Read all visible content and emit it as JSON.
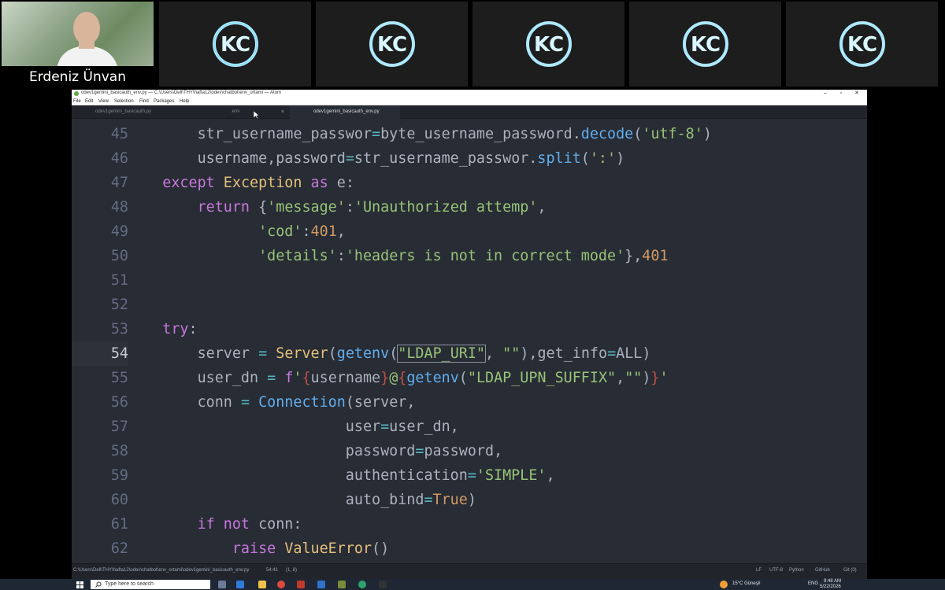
{
  "call": {
    "speaker_name": "Erdeniz Ünvan",
    "participant_logo": "KC",
    "logo_tiles": 5
  },
  "window": {
    "title": "odev1gemini_basicauth_env.py — C:\\Users\\Dell\\THY\\hafta12\\odev\\chatbot\\env_ortami — Atom",
    "controls": [
      "–",
      "▫",
      "✕"
    ]
  },
  "menu": [
    "File",
    "Edit",
    "View",
    "Selection",
    "Find",
    "Packages",
    "Help"
  ],
  "tabs": [
    {
      "label": "odev1gemini_basicauth.py",
      "active": false
    },
    {
      "label": ".env",
      "active": false,
      "close": "×"
    },
    {
      "label": "odev1gemini_basicauth_env.py",
      "active": true
    }
  ],
  "code_lines": [
    {
      "num": "45",
      "tokens": [
        [
          "p",
          "        str_username_passwor"
        ],
        [
          "o",
          "="
        ],
        [
          "p",
          "byte_username_password."
        ],
        [
          "f",
          "decode"
        ],
        [
          "p",
          "("
        ],
        [
          "s",
          "'utf-8'"
        ],
        [
          "p",
          ")"
        ]
      ]
    },
    {
      "num": "46",
      "tokens": [
        [
          "p",
          "        username,password"
        ],
        [
          "o",
          "="
        ],
        [
          "p",
          "str_username_passwor."
        ],
        [
          "f",
          "split"
        ],
        [
          "p",
          "("
        ],
        [
          "s",
          "':'"
        ],
        [
          "p",
          ")"
        ]
      ]
    },
    {
      "num": "47",
      "tokens": [
        [
          "k",
          "    except "
        ],
        [
          "c",
          "Exception"
        ],
        [
          "k",
          " as "
        ],
        [
          "p",
          "e:"
        ]
      ]
    },
    {
      "num": "48",
      "tokens": [
        [
          "k",
          "        return "
        ],
        [
          "p",
          "{"
        ],
        [
          "s",
          "'message'"
        ],
        [
          "p",
          ":"
        ],
        [
          "s",
          "'Unauthorized attemp'"
        ],
        [
          "p",
          ","
        ]
      ]
    },
    {
      "num": "49",
      "tokens": [
        [
          "p",
          "               "
        ],
        [
          "s",
          "'cod'"
        ],
        [
          "p",
          ":"
        ],
        [
          "n",
          "401"
        ],
        [
          "p",
          ","
        ]
      ]
    },
    {
      "num": "50",
      "tokens": [
        [
          "p",
          "               "
        ],
        [
          "s",
          "'details'"
        ],
        [
          "p",
          ":"
        ],
        [
          "s",
          "'headers is not in correct mode'"
        ],
        [
          "p",
          "},"
        ],
        [
          "n",
          "401"
        ]
      ]
    },
    {
      "num": "51",
      "tokens": []
    },
    {
      "num": "52",
      "tokens": []
    },
    {
      "num": "53",
      "tokens": [
        [
          "k",
          "    try"
        ],
        [
          "p",
          ":"
        ]
      ]
    },
    {
      "num": "54",
      "cursor": true,
      "tokens": [
        [
          "p",
          "        server "
        ],
        [
          "o",
          "="
        ],
        [
          "p",
          " "
        ],
        [
          "c",
          "Server"
        ],
        [
          "p",
          "("
        ],
        [
          "f",
          "getenv"
        ],
        [
          "p",
          "("
        ],
        [
          "s",
          "\"LDAP_URI\""
        ],
        [
          "p",
          ", "
        ],
        [
          "s",
          "\"\""
        ],
        [
          "p",
          "),get_info"
        ],
        [
          "o",
          "="
        ],
        [
          "p",
          "ALL)"
        ]
      ]
    },
    {
      "num": "55",
      "tokens": [
        [
          "p",
          "        user_dn "
        ],
        [
          "o",
          "="
        ],
        [
          "p",
          " "
        ],
        [
          "k",
          "f"
        ],
        [
          "s",
          "'"
        ],
        [
          "e",
          "{"
        ],
        [
          "p",
          "username"
        ],
        [
          "e",
          "}"
        ],
        [
          "s",
          "@"
        ],
        [
          "e",
          "{"
        ],
        [
          "f",
          "getenv"
        ],
        [
          "p",
          "("
        ],
        [
          "s",
          "\"LDAP_UPN_SUFFIX\""
        ],
        [
          "p",
          ","
        ],
        [
          "s",
          "\"\""
        ],
        [
          "p",
          ")"
        ],
        [
          "e",
          "}"
        ],
        [
          "s",
          "'"
        ]
      ]
    },
    {
      "num": "56",
      "tokens": [
        [
          "p",
          "        conn "
        ],
        [
          "o",
          "="
        ],
        [
          "p",
          " "
        ],
        [
          "f",
          "Connection"
        ],
        [
          "p",
          "(server,"
        ]
      ]
    },
    {
      "num": "57",
      "tokens": [
        [
          "p",
          "                         user"
        ],
        [
          "o",
          "="
        ],
        [
          "p",
          "user_dn,"
        ]
      ]
    },
    {
      "num": "58",
      "tokens": [
        [
          "p",
          "                         password"
        ],
        [
          "o",
          "="
        ],
        [
          "p",
          "password,"
        ]
      ]
    },
    {
      "num": "59",
      "tokens": [
        [
          "p",
          "                         authentication"
        ],
        [
          "o",
          "="
        ],
        [
          "s",
          "'SIMPLE'"
        ],
        [
          "p",
          ","
        ]
      ]
    },
    {
      "num": "60",
      "tokens": [
        [
          "p",
          "                         auto_bind"
        ],
        [
          "o",
          "="
        ],
        [
          "n",
          "True"
        ],
        [
          "p",
          ")"
        ]
      ]
    },
    {
      "num": "61",
      "tokens": [
        [
          "k",
          "        if not "
        ],
        [
          "p",
          "conn:"
        ]
      ]
    },
    {
      "num": "62",
      "tokens": [
        [
          "k",
          "            raise "
        ],
        [
          "c",
          "ValueError"
        ],
        [
          "p",
          "()"
        ]
      ]
    }
  ],
  "status": {
    "path": "C:\\Users\\Dell\\THY\\hafta12\\odev\\chatbot\\env_ortami\\odev1gemini_basicauth_env.py",
    "cursor": "54:41",
    "selection": "(1, 8)",
    "line_ending": "LF",
    "encoding": "UTF-8",
    "grammar": "Python",
    "github": "GitHub",
    "git": "Git (0)"
  },
  "taskbar": {
    "search_placeholder": "Type here to search",
    "weather": "15°C  Güneşli",
    "language": "ENG",
    "time": "9:48 AM",
    "date": "5/22/2026"
  },
  "colors": {
    "editor_bg": "#282c34",
    "keyword": "#c678dd",
    "string": "#98c379",
    "function": "#61afef",
    "class": "#e5c07b",
    "number": "#d19a66"
  }
}
